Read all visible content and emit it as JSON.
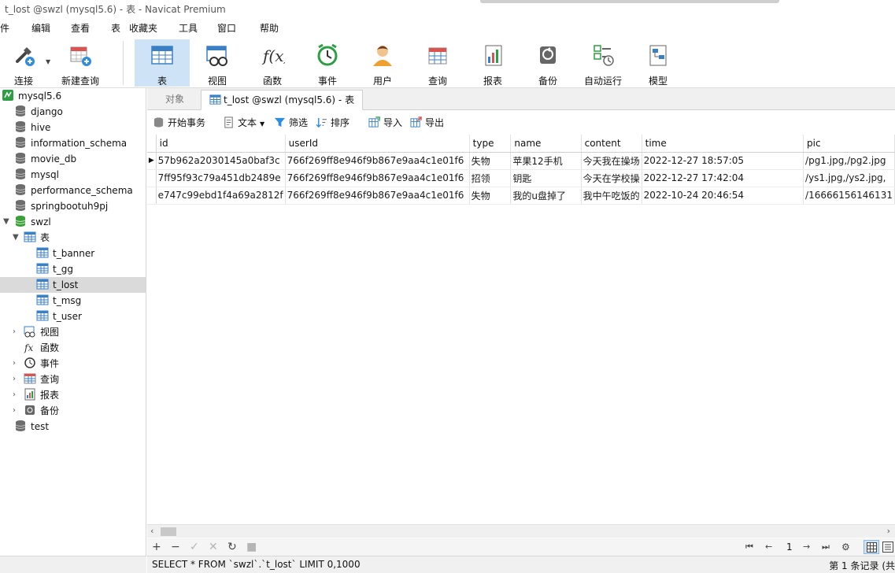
{
  "window": {
    "title": "t_lost @swzl (mysql5.6) - 表 - Navicat Premium"
  },
  "menu": [
    "文件",
    "编辑",
    "查看",
    "表",
    "收藏夹",
    "工具",
    "窗口",
    "帮助"
  ],
  "toolbar": {
    "connect": "连接",
    "new_query": "新建查询",
    "table": "表",
    "view": "视图",
    "function": "函数",
    "event": "事件",
    "user": "用户",
    "query": "查询",
    "report": "报表",
    "backup": "备份",
    "autorun": "自动运行",
    "model": "模型"
  },
  "tree": {
    "connection": "mysql5.6",
    "databases": [
      "django",
      "hive",
      "information_schema",
      "movie_db",
      "mysql",
      "performance_schema",
      "springbootuh9pj",
      "swzl"
    ],
    "tables_group": "表",
    "tables": [
      "t_banner",
      "t_gg",
      "t_lost",
      "t_msg",
      "t_user"
    ],
    "groups": [
      "视图",
      "函数",
      "事件",
      "查询",
      "报表",
      "备份"
    ],
    "last_db": "test"
  },
  "tabs": {
    "objects": "对象",
    "current": "t_lost @swzl (mysql5.6) - 表"
  },
  "subtoolbar": {
    "begin_tx": "开始事务",
    "text": "文本",
    "filter": "筛选",
    "sort": "排序",
    "import": "导入",
    "export": "导出"
  },
  "grid": {
    "columns": [
      "id",
      "userId",
      "type",
      "name",
      "content",
      "time",
      "pic"
    ],
    "rows": [
      [
        "57b962a2030145a0baf3c",
        "766f269ff8e946f9b867e9aa4c1e01f6",
        "失物",
        "苹果12手机",
        "今天我在操场",
        "2022-12-27 18:57:05",
        "/pg1.jpg,/pg2.jpg"
      ],
      [
        "7ff95f93c79a451db2489e",
        "766f269ff8e946f9b867e9aa4c1e01f6",
        "招领",
        "钥匙",
        "今天在学校操",
        "2022-12-27 17:42:04",
        "/ys1.jpg,/ys2.jpg,"
      ],
      [
        "e747c99ebd1f4a69a2812f",
        "766f269ff8e946f9b867e9aa4c1e01f6",
        "失物",
        "我的u盘掉了",
        "我中午吃饭的",
        "2022-10-24 20:46:54",
        "/16666156146131"
      ]
    ]
  },
  "pager": {
    "page": "1"
  },
  "status": {
    "sql": "SELECT * FROM `swzl`.`t_lost` LIMIT 0,1000",
    "records": "第 1 条记录 (共"
  },
  "colors": {
    "accent": "#cfe3f7",
    "db_icon": "#6d6d6d",
    "db_active": "#3aa13a",
    "table_icon": "#3b7fc4"
  }
}
